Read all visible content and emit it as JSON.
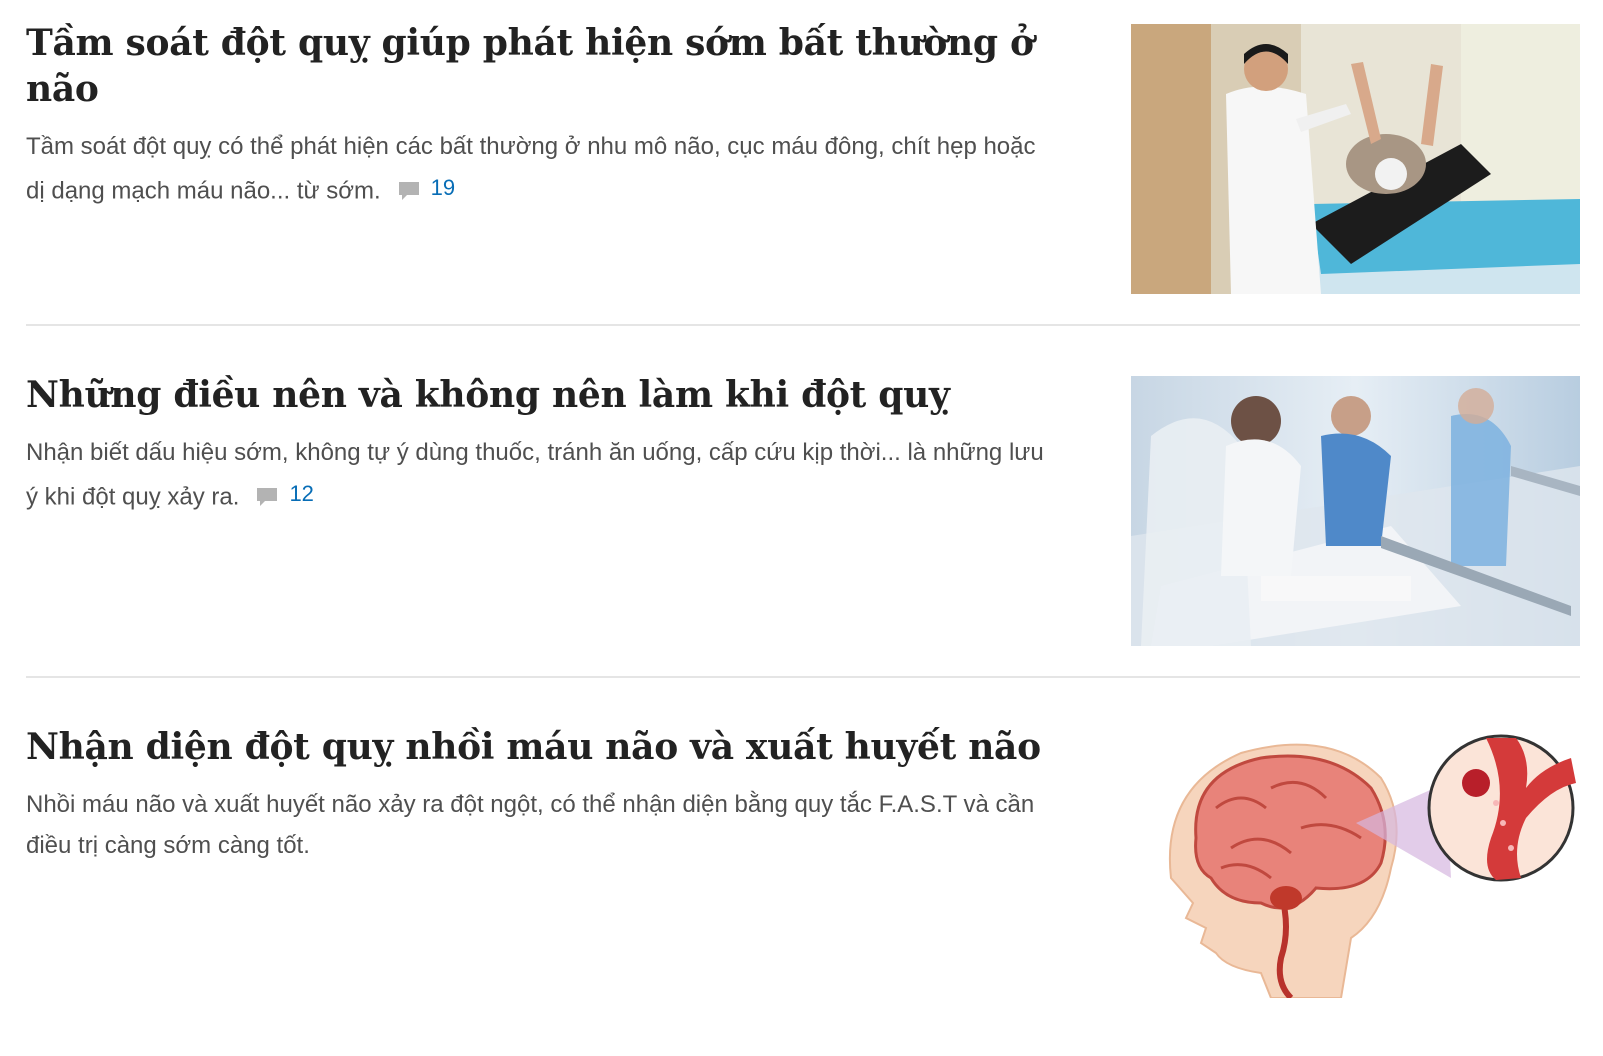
{
  "articles": [
    {
      "title": "Tầm soát đột quỵ giúp phát hiện sớm bất thường ở não",
      "description": "Tầm soát đột quỵ có thể phát hiện các bất thường ở nhu mô não, cục máu đông, chít hẹp hoặc dị dạng mạch máu não... từ sớm.",
      "comment_count": "19",
      "thumbnail": "doctor-examining-patient-photo"
    },
    {
      "title": "Những điều nên và không nên làm khi đột quỵ",
      "description": "Nhận biết dấu hiệu sớm, không tự ý dùng thuốc, tránh ăn uống, cấp cứu kịp thời... là những lưu ý khi đột quỵ xảy ra.",
      "comment_count": "12",
      "thumbnail": "emergency-stretcher-photo"
    },
    {
      "title": "Nhận diện đột quỵ nhồi máu não và xuất huyết não",
      "description": "Nhồi máu não và xuất huyết não xảy ra đột ngột, có thể nhận diện bằng quy tắc F.A.S.T và cần điều trị càng sớm càng tốt.",
      "comment_count": "",
      "thumbnail": "brain-illustration"
    }
  ],
  "colors": {
    "title": "#222222",
    "description": "#4f4f4f",
    "comment_link": "#076db6",
    "divider": "#e5e5e5"
  },
  "icons": {
    "comment": "speech-bubble-icon"
  }
}
